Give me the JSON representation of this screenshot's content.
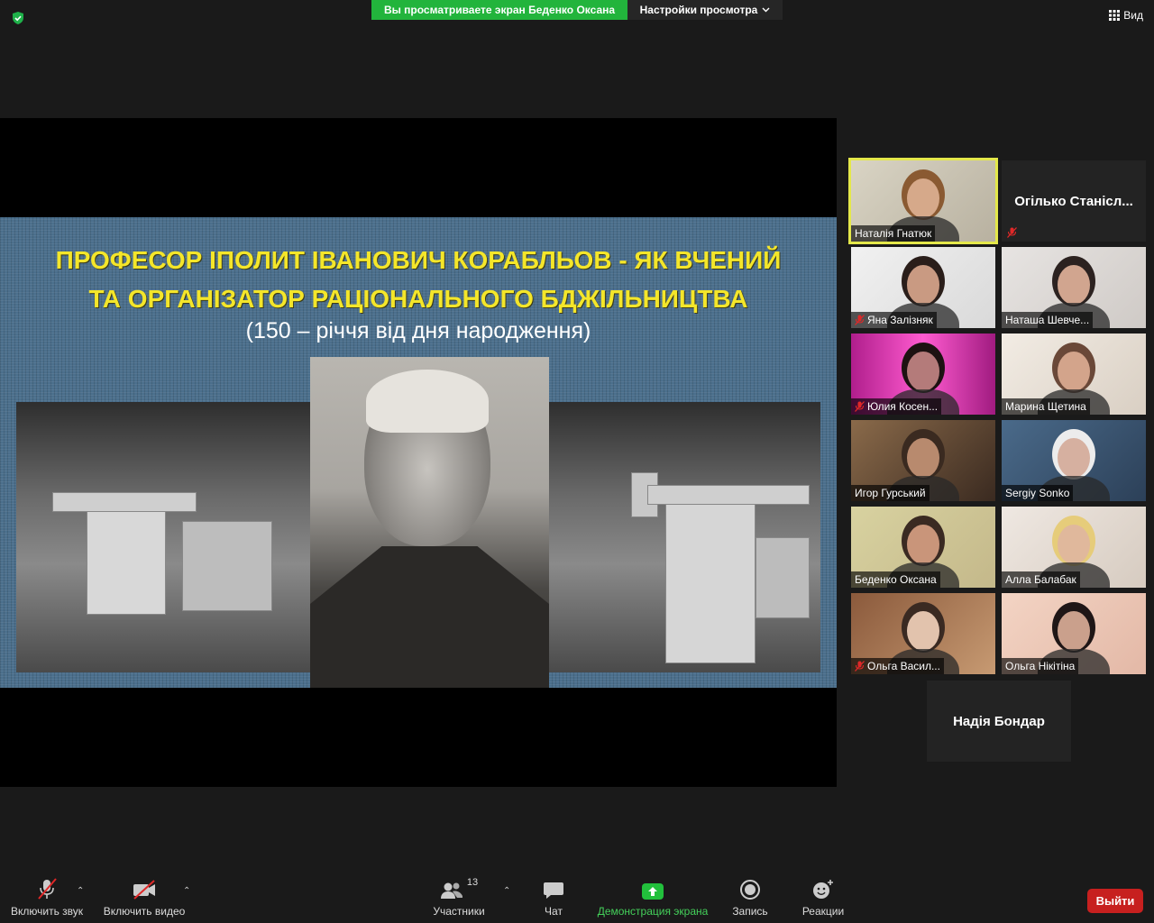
{
  "top": {
    "banner_text": "Вы просматриваете экран Беденко Оксана",
    "view_settings": "Настройки просмотра",
    "view_label": "Вид"
  },
  "slide": {
    "title_line1": "ПРОФЕСОР ІПОЛИТ ІВАНОВИЧ КОРАБЛЬОВ - ЯК ВЧЕНИЙ",
    "title_line2": "ТА ОРГАНІЗАТОР РАЦІОНАЛЬНОГО БДЖІЛЬНИЦТВА",
    "subtitle": "(150 – річчя від дня народження)"
  },
  "participants": [
    {
      "name": "Наталія Гнатюк",
      "muted": false,
      "video": true,
      "active": true
    },
    {
      "name": "Огілько Станісл...",
      "muted": true,
      "video": false,
      "active": false
    },
    {
      "name": "Яна Залізняк",
      "muted": true,
      "video": true,
      "active": false
    },
    {
      "name": "Наташа Шевче...",
      "muted": false,
      "video": true,
      "active": false
    },
    {
      "name": "Юлия Косен...",
      "muted": true,
      "video": true,
      "active": false
    },
    {
      "name": "Марина Щетина",
      "muted": false,
      "video": true,
      "active": false
    },
    {
      "name": "Игор Гурський",
      "muted": false,
      "video": true,
      "active": false
    },
    {
      "name": "Sergiy Sonko",
      "muted": false,
      "video": true,
      "active": false
    },
    {
      "name": "Беденко Оксана",
      "muted": false,
      "video": true,
      "active": false
    },
    {
      "name": "Алла Балабак",
      "muted": false,
      "video": true,
      "active": false
    },
    {
      "name": "Ольга Васил...",
      "muted": true,
      "video": true,
      "active": false
    },
    {
      "name": "Ольга Нікітіна",
      "muted": false,
      "video": true,
      "active": false
    },
    {
      "name": "Надія Бондар",
      "muted": false,
      "video": false,
      "active": false
    }
  ],
  "toolbar": {
    "audio": "Включить звук",
    "video": "Включить видео",
    "participants": "Участники",
    "participants_count": "13",
    "chat": "Чат",
    "share": "Демонстрация экрана",
    "record": "Запись",
    "reactions": "Реакции",
    "leave": "Выйти"
  },
  "colors": {
    "accent_green": "#22b43c",
    "leave_red": "#c7201f",
    "title_yellow": "#f4e62a",
    "active_speaker": "#e4e84a"
  }
}
